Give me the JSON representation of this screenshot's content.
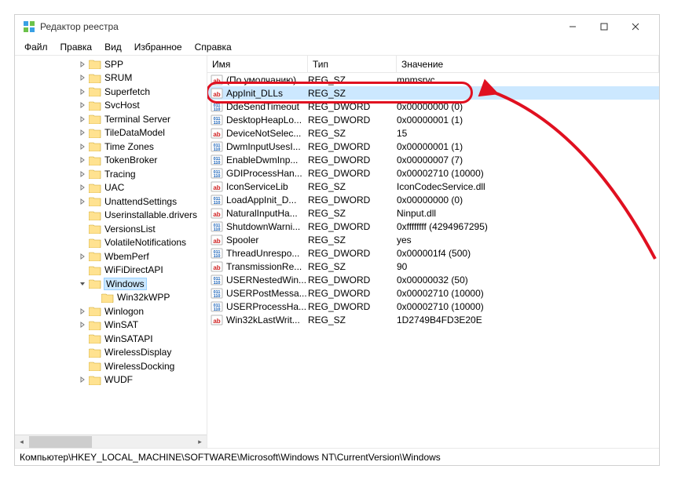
{
  "titlebar": {
    "title": "Редактор реестра"
  },
  "menu": [
    "Файл",
    "Правка",
    "Вид",
    "Избранное",
    "Справка"
  ],
  "tree": {
    "items": [
      {
        "depth": 5,
        "toggle": ">",
        "label": "SPP"
      },
      {
        "depth": 5,
        "toggle": ">",
        "label": "SRUM"
      },
      {
        "depth": 5,
        "toggle": ">",
        "label": "Superfetch"
      },
      {
        "depth": 5,
        "toggle": ">",
        "label": "SvcHost"
      },
      {
        "depth": 5,
        "toggle": ">",
        "label": "Terminal Server"
      },
      {
        "depth": 5,
        "toggle": ">",
        "label": "TileDataModel"
      },
      {
        "depth": 5,
        "toggle": ">",
        "label": "Time Zones"
      },
      {
        "depth": 5,
        "toggle": ">",
        "label": "TokenBroker"
      },
      {
        "depth": 5,
        "toggle": ">",
        "label": "Tracing"
      },
      {
        "depth": 5,
        "toggle": ">",
        "label": "UAC"
      },
      {
        "depth": 5,
        "toggle": ">",
        "label": "UnattendSettings"
      },
      {
        "depth": 5,
        "toggle": "",
        "label": "Userinstallable.drivers"
      },
      {
        "depth": 5,
        "toggle": "",
        "label": "VersionsList"
      },
      {
        "depth": 5,
        "toggle": "",
        "label": "VolatileNotifications"
      },
      {
        "depth": 5,
        "toggle": ">",
        "label": "WbemPerf"
      },
      {
        "depth": 5,
        "toggle": "",
        "label": "WiFiDirectAPI"
      },
      {
        "depth": 5,
        "toggle": "v",
        "label": "Windows",
        "selected": true
      },
      {
        "depth": 6,
        "toggle": "",
        "label": "Win32kWPP"
      },
      {
        "depth": 5,
        "toggle": ">",
        "label": "Winlogon"
      },
      {
        "depth": 5,
        "toggle": ">",
        "label": "WinSAT"
      },
      {
        "depth": 5,
        "toggle": "",
        "label": "WinSATAPI"
      },
      {
        "depth": 5,
        "toggle": "",
        "label": "WirelessDisplay"
      },
      {
        "depth": 5,
        "toggle": "",
        "label": "WirelessDocking"
      },
      {
        "depth": 5,
        "toggle": ">",
        "label": "WUDF"
      }
    ]
  },
  "columns": {
    "name": "Имя",
    "type": "Тип",
    "value": "Значение"
  },
  "rows": [
    {
      "icon": "sz",
      "name": "(По умолчанию)",
      "type": "REG_SZ",
      "value": "mnmsrvc"
    },
    {
      "icon": "sz",
      "name": "AppInit_DLLs",
      "type": "REG_SZ",
      "value": "",
      "highlight": true,
      "selected": true
    },
    {
      "icon": "dw",
      "name": "DdeSendTimeout",
      "type": "REG_DWORD",
      "value": "0x00000000 (0)"
    },
    {
      "icon": "dw",
      "name": "DesktopHeapLo...",
      "type": "REG_DWORD",
      "value": "0x00000001 (1)"
    },
    {
      "icon": "sz",
      "name": "DeviceNotSelec...",
      "type": "REG_SZ",
      "value": "15"
    },
    {
      "icon": "dw",
      "name": "DwmInputUsesI...",
      "type": "REG_DWORD",
      "value": "0x00000001 (1)"
    },
    {
      "icon": "dw",
      "name": "EnableDwmInp...",
      "type": "REG_DWORD",
      "value": "0x00000007 (7)"
    },
    {
      "icon": "dw",
      "name": "GDIProcessHan...",
      "type": "REG_DWORD",
      "value": "0x00002710 (10000)"
    },
    {
      "icon": "sz",
      "name": "IconServiceLib",
      "type": "REG_SZ",
      "value": "IconCodecService.dll"
    },
    {
      "icon": "dw",
      "name": "LoadAppInit_D...",
      "type": "REG_DWORD",
      "value": "0x00000000 (0)"
    },
    {
      "icon": "sz",
      "name": "NaturalInputHa...",
      "type": "REG_SZ",
      "value": "Ninput.dll"
    },
    {
      "icon": "dw",
      "name": "ShutdownWarni...",
      "type": "REG_DWORD",
      "value": "0xffffffff (4294967295)"
    },
    {
      "icon": "sz",
      "name": "Spooler",
      "type": "REG_SZ",
      "value": "yes"
    },
    {
      "icon": "dw",
      "name": "ThreadUnrespo...",
      "type": "REG_DWORD",
      "value": "0x000001f4 (500)"
    },
    {
      "icon": "sz",
      "name": "TransmissionRe...",
      "type": "REG_SZ",
      "value": "90"
    },
    {
      "icon": "dw",
      "name": "USERNestedWin...",
      "type": "REG_DWORD",
      "value": "0x00000032 (50)"
    },
    {
      "icon": "dw",
      "name": "USERPostMessa...",
      "type": "REG_DWORD",
      "value": "0x00002710 (10000)"
    },
    {
      "icon": "dw",
      "name": "USERProcessHa...",
      "type": "REG_DWORD",
      "value": "0x00002710 (10000)"
    },
    {
      "icon": "sz",
      "name": "Win32kLastWrit...",
      "type": "REG_SZ",
      "value": "1D2749B4FD3E20E"
    }
  ],
  "status": "Компьютер\\HKEY_LOCAL_MACHINE\\SOFTWARE\\Microsoft\\Windows NT\\CurrentVersion\\Windows"
}
